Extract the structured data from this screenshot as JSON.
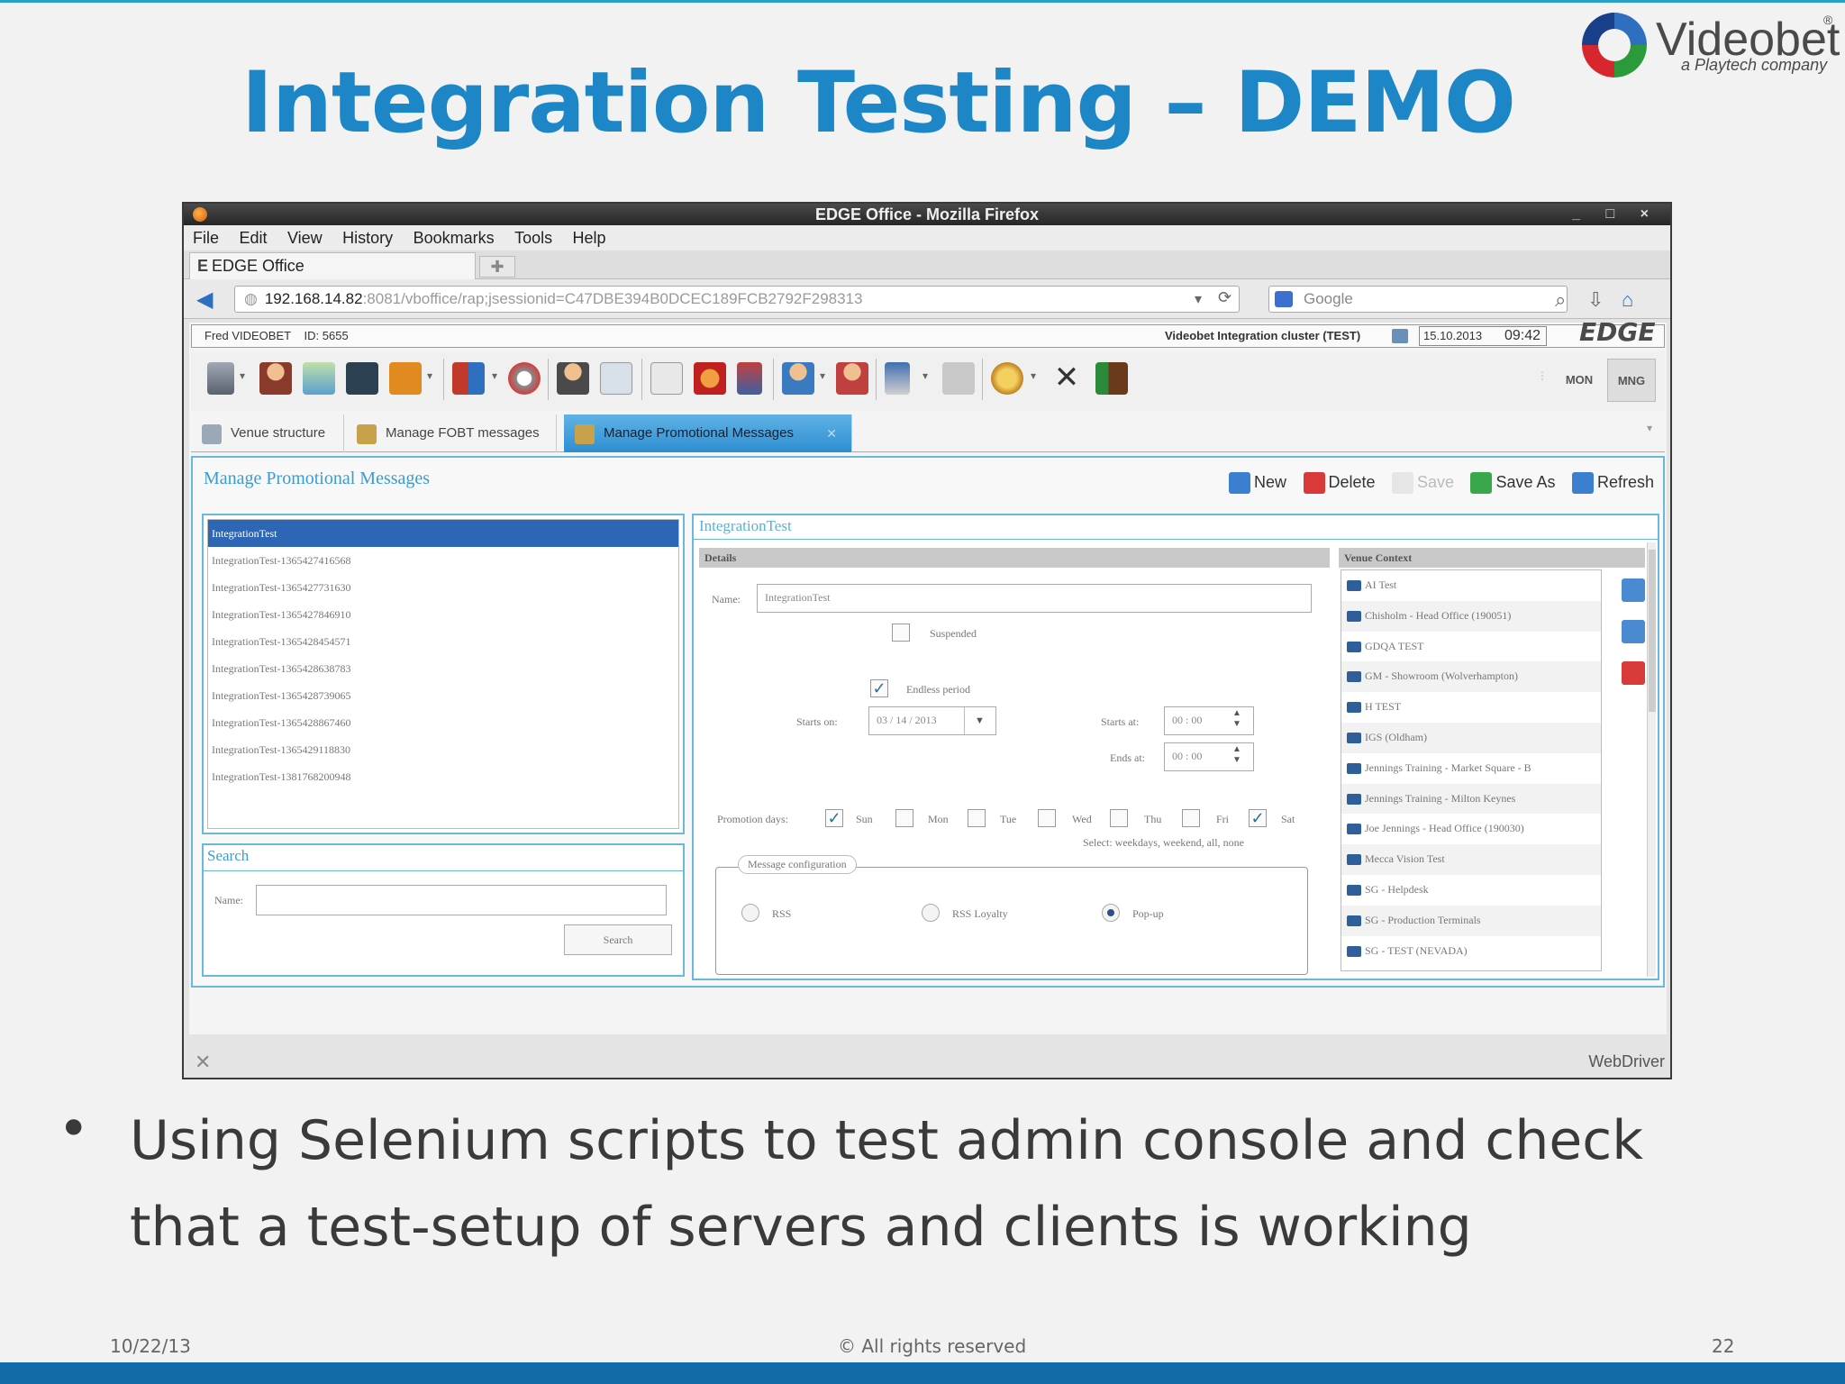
{
  "slide": {
    "title": "Integration Testing – DEMO",
    "logo_name": "Videobet",
    "logo_reg": "®",
    "logo_tagline": "a Playtech company",
    "bullet": "Using Selenium scripts to test admin console and check that a test-setup of servers and clients is working",
    "bullet_line1": "Using Selenium scripts to test admin console and check",
    "bullet_line2": "that a test-setup of servers and clients is working",
    "footer_date": "10/22/13",
    "footer_copyright": "© All rights reserved",
    "page_number": "22"
  },
  "browser": {
    "window_title": "EDGE Office - Mozilla Firefox",
    "window_controls": "_ □ ×",
    "menu": [
      "File",
      "Edit",
      "View",
      "History",
      "Bookmarks",
      "Tools",
      "Help"
    ],
    "tab_label": "EDGE Office",
    "url_host": "192.168.14.82",
    "url_rest": ":8081/vboffice/rap;jsessionid=C47DBE394B0DCEC189FCB2792F298313",
    "search_placeholder": "Google",
    "status_right": "WebDriver"
  },
  "app": {
    "user": "Fred VIDEOBET",
    "user_id": "ID: 5655",
    "cluster": "Videobet Integration cluster (TEST)",
    "date": "15.10.2013",
    "time": "09:42",
    "brand": "EDGE",
    "mode_mon": "MON",
    "mode_mng": "MNG",
    "tabs": [
      "Venue structure",
      "Manage FOBT messages",
      "Manage Promotional Messages"
    ],
    "panel_title": "Manage Promotional Messages",
    "actions": [
      "New",
      "Delete",
      "Save",
      "Save As",
      "Refresh"
    ],
    "messages": [
      "IntegrationTest",
      "IntegrationTest-1365427416568",
      "IntegrationTest-1365427731630",
      "IntegrationTest-1365427846910",
      "IntegrationTest-1365428454571",
      "IntegrationTest-1365428638783",
      "IntegrationTest-1365428739065",
      "IntegrationTest-1365428867460",
      "IntegrationTest-1365429118830",
      "IntegrationTest-1381768200948"
    ],
    "search": {
      "title": "Search",
      "name_label": "Name:",
      "button": "Search"
    },
    "detail": {
      "header": "IntegrationTest",
      "details_label": "Details",
      "name_label": "Name:",
      "name_value": "IntegrationTest",
      "suspended": "Suspended",
      "endless": "Endless period",
      "starts_on_label": "Starts on:",
      "starts_on": "03 / 14 / 2013",
      "starts_at_label": "Starts at:",
      "starts_at": "00 : 00",
      "ends_at_label": "Ends at:",
      "ends_at": "00 : 00",
      "promo_days_label": "Promotion days:",
      "days": [
        "Sun",
        "Mon",
        "Tue",
        "Wed",
        "Thu",
        "Fri",
        "Sat"
      ],
      "select_hint": "Select: weekdays, weekend, all, none",
      "msg_config": "Message configuration",
      "radio_rss": "RSS",
      "radio_rss_loyalty": "RSS Loyalty",
      "radio_popup": "Pop-up"
    },
    "venue_context": {
      "title": "Venue Context",
      "items": [
        "AI Test",
        "Chisholm - Head Office (190051)",
        "GDQA TEST",
        "GM - Showroom (Wolverhampton)",
        "H TEST",
        "IGS (Oldham)",
        "Jennings Training - Market Square - B",
        "Jennings Training - Milton Keynes",
        "Joe Jennings - Head Office (190030)",
        "Mecca Vision Test",
        "SG - Helpdesk",
        "SG - Production Terminals",
        "SG - TEST (NEVADA)"
      ]
    }
  }
}
